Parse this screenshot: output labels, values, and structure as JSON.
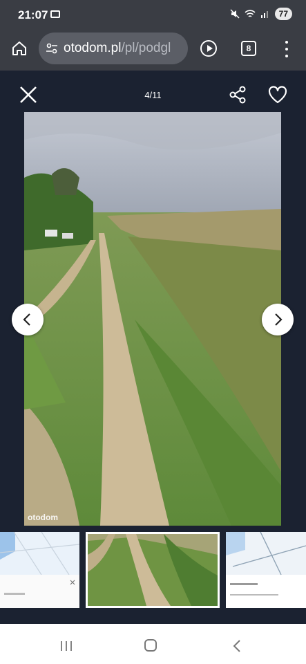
{
  "status_bar": {
    "time": "21:07",
    "battery": "77"
  },
  "browser": {
    "url_domain": "otodom.pl",
    "url_path": "/pl/podgl",
    "tab_count": "8"
  },
  "viewer": {
    "counter": "4/11",
    "watermark": "otodom"
  },
  "thumbnails": [
    {
      "kind": "map"
    },
    {
      "kind": "photo",
      "selected": true
    },
    {
      "kind": "map"
    }
  ]
}
